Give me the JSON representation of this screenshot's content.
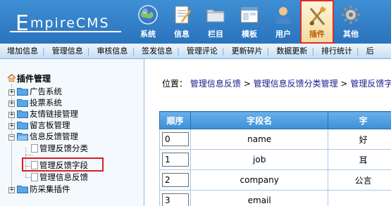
{
  "header": {
    "logo": {
      "first": "E",
      "rest": "mpireCMS"
    },
    "nav": [
      {
        "label": "系统",
        "icon": "globe-icon",
        "active": false
      },
      {
        "label": "信息",
        "icon": "notepad-icon",
        "active": false
      },
      {
        "label": "栏目",
        "icon": "folder-icon",
        "active": false
      },
      {
        "label": "模板",
        "icon": "window-icon",
        "active": false
      },
      {
        "label": "用户",
        "icon": "user-icon",
        "active": false
      },
      {
        "label": "插件",
        "icon": "tools-icon",
        "active": true
      },
      {
        "label": "其他",
        "icon": "gear-icon",
        "active": false
      }
    ],
    "colors": {
      "header_bg": "#2a73bd",
      "active_border": "#e8282d"
    }
  },
  "submenu": [
    "增加信息",
    "管理信息",
    "审核信息",
    "签发信息",
    "管理评论",
    "更新碎片",
    "数据更新",
    "排行统计",
    "后"
  ],
  "tree": {
    "title": "插件管理",
    "items": [
      {
        "label": "广告系统",
        "type": "folder",
        "expanded": false
      },
      {
        "label": "投票系统",
        "type": "folder",
        "expanded": false
      },
      {
        "label": "友情链接管理",
        "type": "folder",
        "expanded": false
      },
      {
        "label": "留言板管理",
        "type": "folder",
        "expanded": false
      },
      {
        "label": "信息反馈管理",
        "type": "folder",
        "expanded": true
      },
      {
        "label": "管理反馈分类",
        "type": "doc"
      },
      {
        "label": "管理反馈字段",
        "type": "doc",
        "selected": true
      },
      {
        "label": "管理信息反馈",
        "type": "doc"
      },
      {
        "label": "防采集插件",
        "type": "folder",
        "expanded": false
      }
    ]
  },
  "breadcrumb": {
    "prefix": "位置：",
    "links": [
      "管理信息反馈",
      "管理信息反馈分类管理",
      "管理反馈字段"
    ],
    "sep": ">"
  },
  "table": {
    "headers": [
      "顺序",
      "字段名",
      "字"
    ],
    "rows": [
      {
        "order": "0",
        "field": "name",
        "extra": "好"
      },
      {
        "order": "1",
        "field": "job",
        "extra": "耳"
      },
      {
        "order": "2",
        "field": "company",
        "extra": "公言"
      },
      {
        "order": "3",
        "field": "email",
        "extra": ""
      }
    ]
  }
}
